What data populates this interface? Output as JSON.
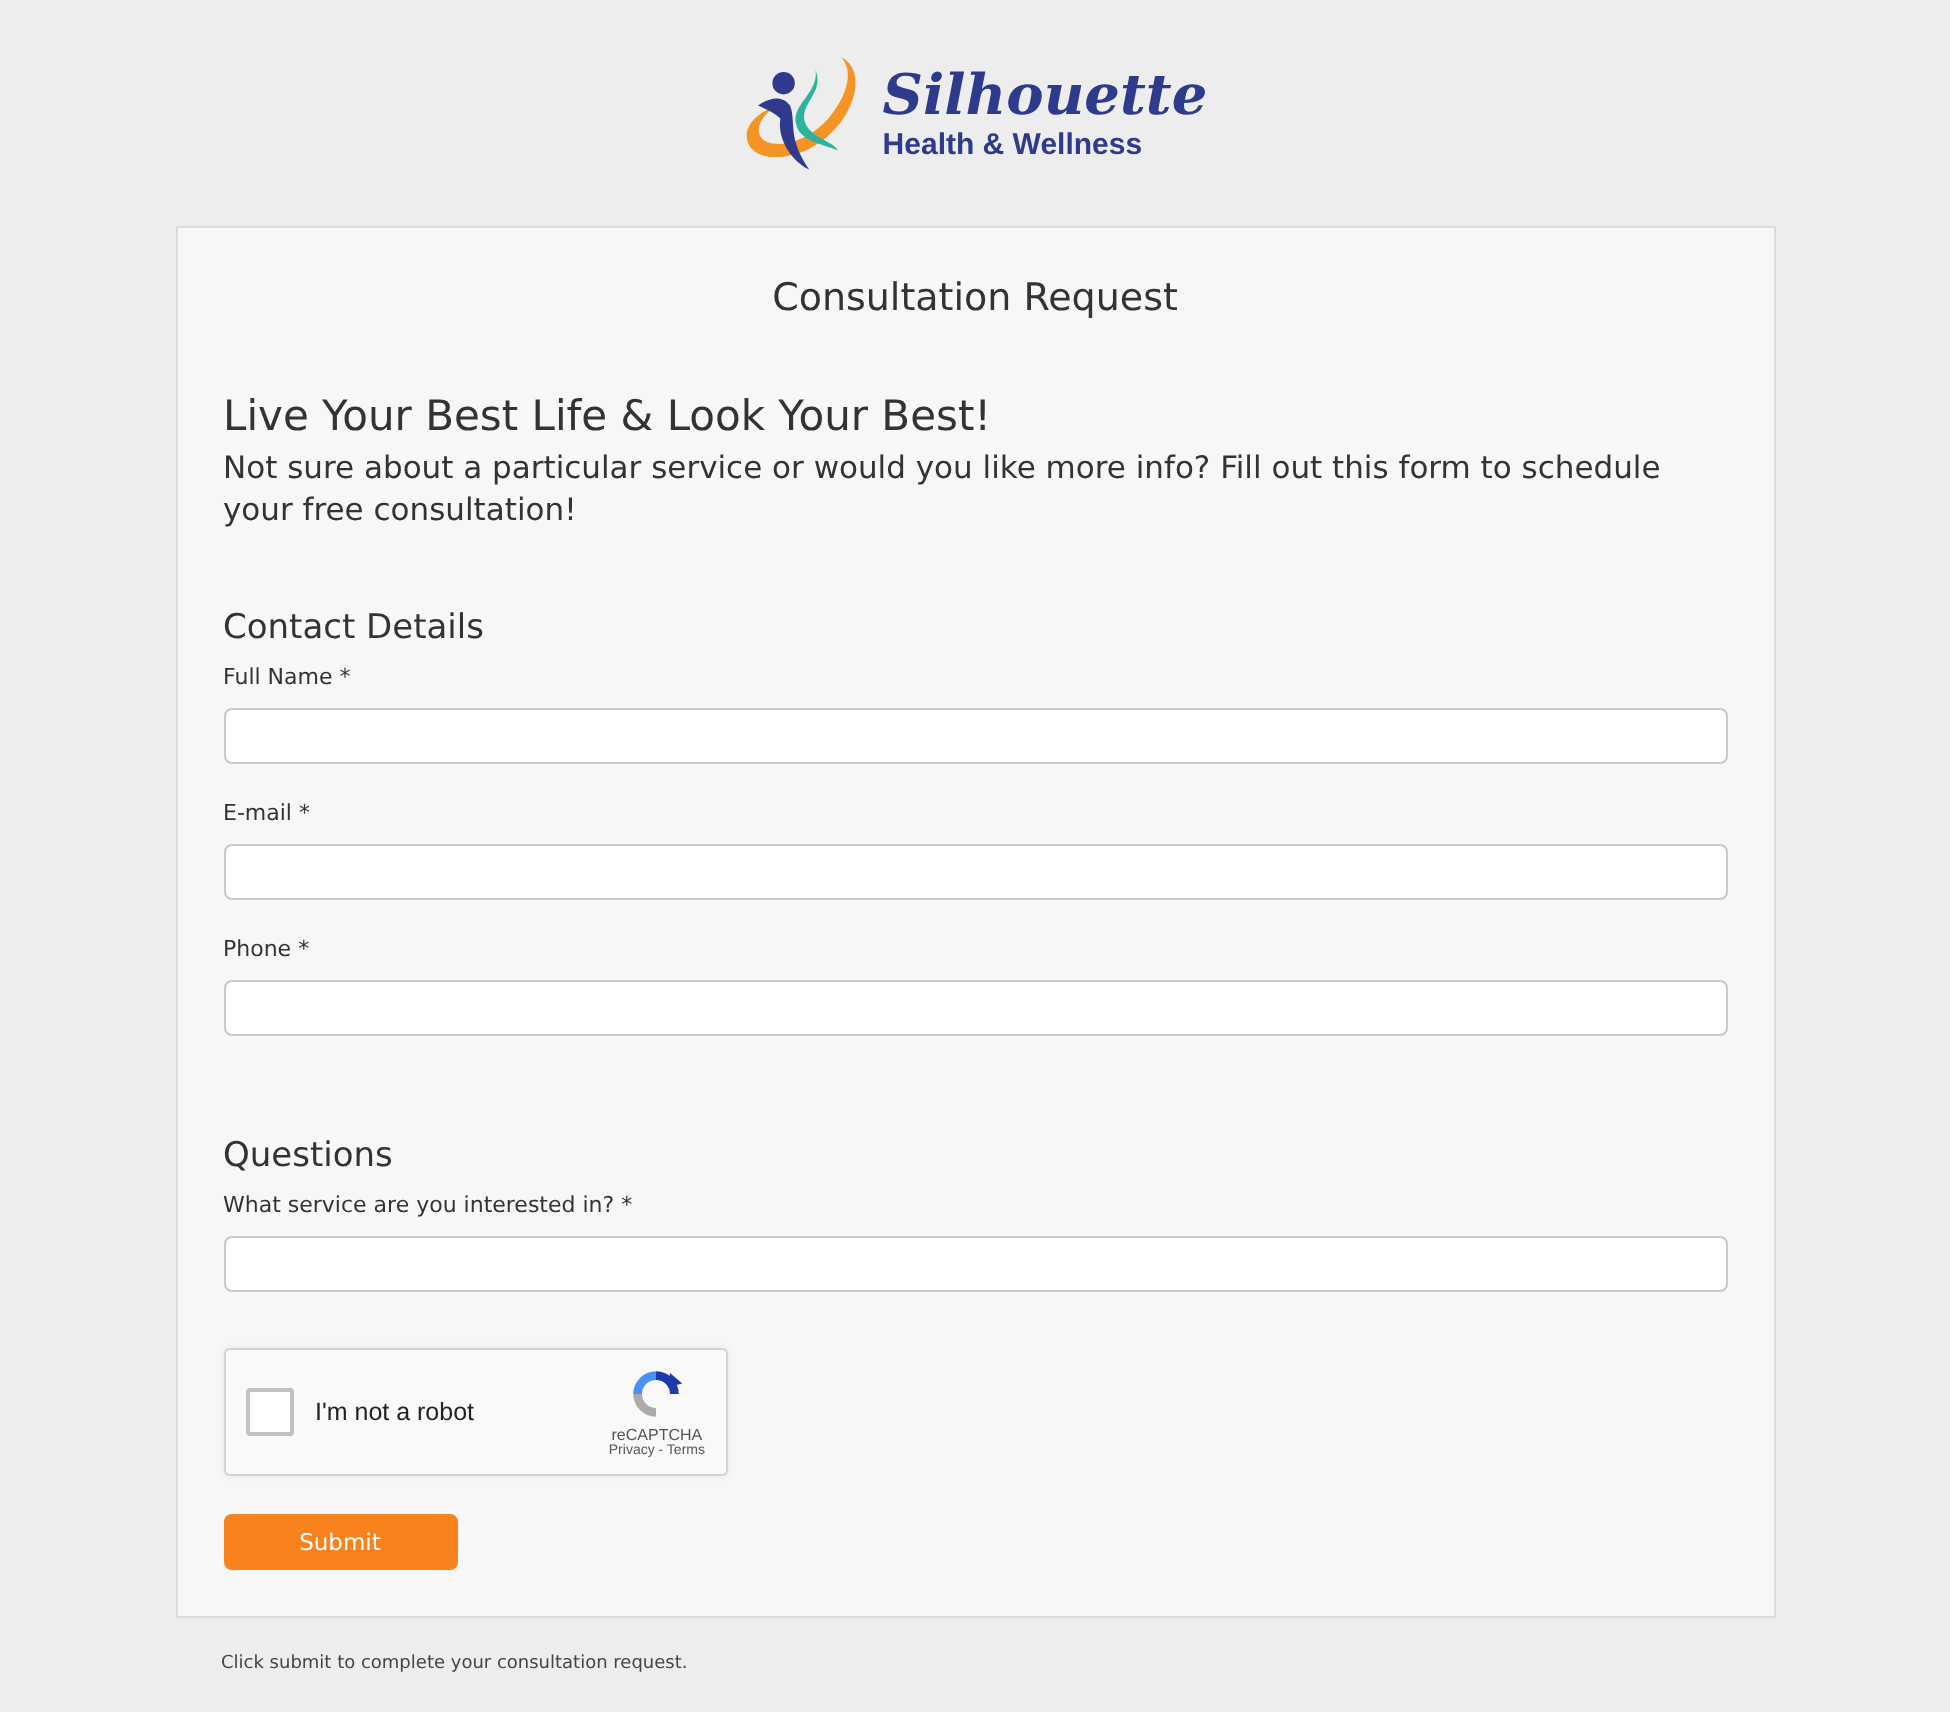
{
  "logo": {
    "name": "Silhouette",
    "tagline": "Health & Wellness"
  },
  "form": {
    "title": "Consultation Request",
    "headline": "Live Your Best Life & Look Your Best!",
    "intro": "Not sure about a particular service or would you like more info? Fill out this form to schedule your free consultation!",
    "sections": [
      {
        "heading": "Contact Details",
        "fields": [
          {
            "label": "Full Name *"
          },
          {
            "label": "E-mail *"
          },
          {
            "label": "Phone *"
          }
        ]
      },
      {
        "heading": "Questions",
        "fields": [
          {
            "label": "What service are you interested in? *"
          }
        ]
      }
    ],
    "captcha": {
      "checked": false,
      "label": "I'm not a robot",
      "brand": "reCAPTCHA",
      "links": "Privacy - Terms"
    },
    "submit": "Submit"
  },
  "footer": "Click submit to complete your consultation request."
}
